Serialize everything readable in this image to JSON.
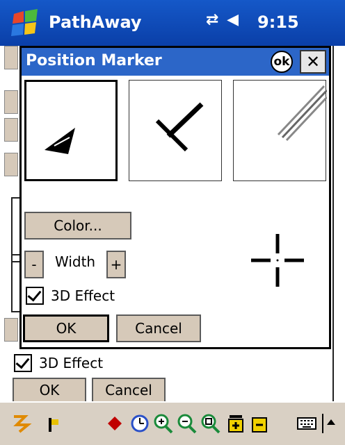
{
  "system_bar": {
    "app_name": "PathAway",
    "connectivity_icon": "sync-arrows-icon",
    "volume_icon": "speaker-icon",
    "time": "9:15"
  },
  "dialog": {
    "title": "Position Marker",
    "ok_icon_label": "ok",
    "close_icon_label": "✕",
    "marker_options": [
      {
        "name": "arrowhead",
        "selected": true
      },
      {
        "name": "t-marker",
        "selected": false
      },
      {
        "name": "double-line",
        "selected": false
      }
    ],
    "color_button": "Color...",
    "minus_button": "-",
    "width_label": "Width",
    "plus_button": "+",
    "effect_checkbox_label": "3D Effect",
    "effect_checked": true,
    "ok_button": "OK",
    "cancel_button": "Cancel",
    "preview_icon": "crosshair-icon"
  },
  "background_screen": {
    "effect_checkbox_label": "3D Effect",
    "effect_checked": true,
    "ok_button": "OK",
    "cancel_button": "Cancel"
  },
  "toolbar": {
    "icons": [
      "route-icon",
      "flag-icon",
      "waypoint-diamond-icon",
      "clock-icon",
      "zoom-in-icon",
      "zoom-out-icon",
      "zoom-fit-icon",
      "zoom-plus-icon",
      "zoom-minus-icon",
      "keyboard-icon",
      "up-arrow-icon"
    ]
  }
}
